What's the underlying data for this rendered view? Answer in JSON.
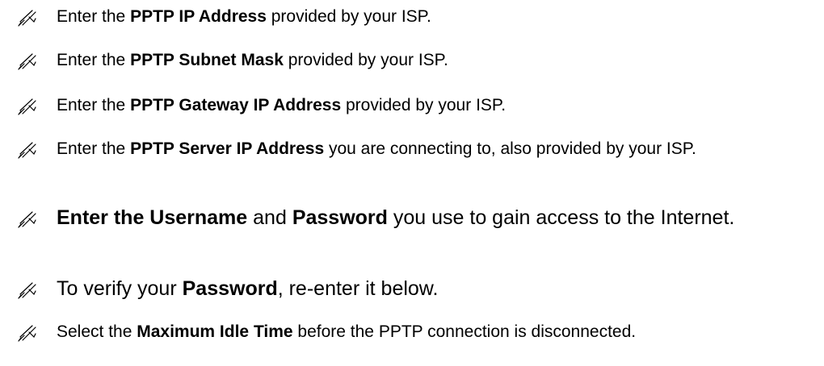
{
  "icon": "writing-hand-icon",
  "items": [
    {
      "before": "Enter the ",
      "bold": "PPTP IP Address",
      "after": " provided by your ISP."
    },
    {
      "before": "Enter the ",
      "bold": "PPTP Subnet Mask",
      "after": " provided by your ISP."
    },
    {
      "before": "Enter the ",
      "bold": "PPTP Gateway IP Address",
      "after": " provided by your ISP."
    },
    {
      "before": "Enter the ",
      "bold": "PPTP Server IP Address",
      "after": " you are connecting to, also provided by your ISP."
    },
    {
      "bold1": "Enter the Username",
      "middle": " and ",
      "bold2": "Password",
      "after": " you use to gain access to the Internet."
    },
    {
      "before": "To verify your ",
      "bold": "Password",
      "after": ", re-enter it below."
    },
    {
      "before": "Select the ",
      "bold": "Maximum Idle Time",
      "after": " before the PPTP connection is disconnected."
    }
  ]
}
